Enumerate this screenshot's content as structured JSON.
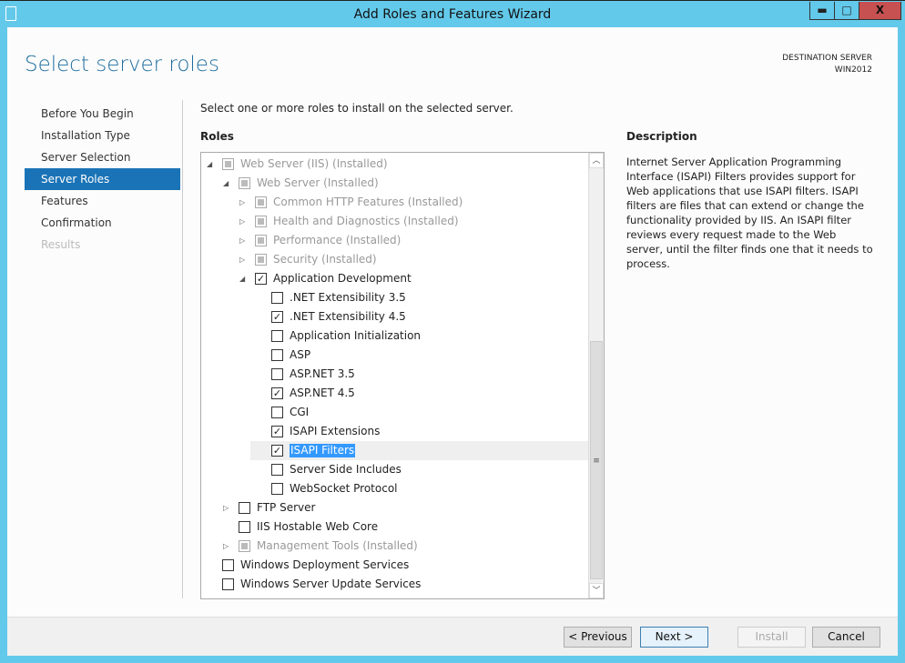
{
  "window": {
    "title": "Add Roles and Features Wizard",
    "minimize": "▬",
    "maximize": "□",
    "close": "X"
  },
  "page": {
    "title": "Select server roles",
    "dest_label": "DESTINATION SERVER",
    "dest_server": "WIN2012"
  },
  "sidebar": {
    "items": [
      {
        "label": "Before You Begin",
        "state": "normal"
      },
      {
        "label": "Installation Type",
        "state": "normal"
      },
      {
        "label": "Server Selection",
        "state": "normal"
      },
      {
        "label": "Server Roles",
        "state": "selected"
      },
      {
        "label": "Features",
        "state": "normal"
      },
      {
        "label": "Confirmation",
        "state": "normal"
      },
      {
        "label": "Results",
        "state": "disabled"
      }
    ]
  },
  "main": {
    "instruction": "Select one or more roles to install on the selected server.",
    "roles_header": "Roles"
  },
  "tree": [
    {
      "label": "Web Server (IIS) (Installed)",
      "level": 0,
      "arrow": "expanded",
      "check": "installed"
    },
    {
      "label": "Web Server (Installed)",
      "level": 1,
      "arrow": "expanded",
      "check": "installed"
    },
    {
      "label": "Common HTTP Features (Installed)",
      "level": 2,
      "arrow": "collapsed",
      "check": "installed"
    },
    {
      "label": "Health and Diagnostics (Installed)",
      "level": 2,
      "arrow": "collapsed",
      "check": "installed"
    },
    {
      "label": "Performance (Installed)",
      "level": 2,
      "arrow": "collapsed",
      "check": "installed"
    },
    {
      "label": "Security (Installed)",
      "level": 2,
      "arrow": "collapsed",
      "check": "installed"
    },
    {
      "label": "Application Development",
      "level": 2,
      "arrow": "expanded",
      "check": "checked"
    },
    {
      "label": ".NET Extensibility 3.5",
      "level": 3,
      "arrow": "none",
      "check": "unchecked"
    },
    {
      "label": ".NET Extensibility 4.5",
      "level": 3,
      "arrow": "none",
      "check": "checked"
    },
    {
      "label": "Application Initialization",
      "level": 3,
      "arrow": "none",
      "check": "unchecked"
    },
    {
      "label": "ASP",
      "level": 3,
      "arrow": "none",
      "check": "unchecked"
    },
    {
      "label": "ASP.NET 3.5",
      "level": 3,
      "arrow": "none",
      "check": "unchecked"
    },
    {
      "label": "ASP.NET 4.5",
      "level": 3,
      "arrow": "none",
      "check": "checked"
    },
    {
      "label": "CGI",
      "level": 3,
      "arrow": "none",
      "check": "unchecked"
    },
    {
      "label": "ISAPI Extensions",
      "level": 3,
      "arrow": "none",
      "check": "checked"
    },
    {
      "label": "ISAPI Filters",
      "level": 3,
      "arrow": "none",
      "check": "checked",
      "selected": true
    },
    {
      "label": "Server Side Includes",
      "level": 3,
      "arrow": "none",
      "check": "unchecked"
    },
    {
      "label": "WebSocket Protocol",
      "level": 3,
      "arrow": "none",
      "check": "unchecked"
    },
    {
      "label": "FTP Server",
      "level": 1,
      "arrow": "collapsed",
      "check": "unchecked"
    },
    {
      "label": "IIS Hostable Web Core",
      "level": 1,
      "arrow": "none",
      "check": "unchecked"
    },
    {
      "label": "Management Tools (Installed)",
      "level": 1,
      "arrow": "collapsed",
      "check": "installed"
    },
    {
      "label": "Windows Deployment Services",
      "level": 0,
      "arrow": "none",
      "check": "unchecked"
    },
    {
      "label": "Windows Server Update Services",
      "level": 0,
      "arrow": "none",
      "check": "unchecked"
    }
  ],
  "description": {
    "header": "Description",
    "text": "Internet Server Application Programming Interface (ISAPI) Filters provides support for Web applications that use ISAPI filters. ISAPI filters are files that can extend or change the functionality provided by IIS. An ISAPI filter reviews every request made to the Web server, until the filter finds one that it needs to process."
  },
  "buttons": {
    "previous": "< Previous",
    "next": "Next >",
    "install": "Install",
    "cancel": "Cancel"
  }
}
